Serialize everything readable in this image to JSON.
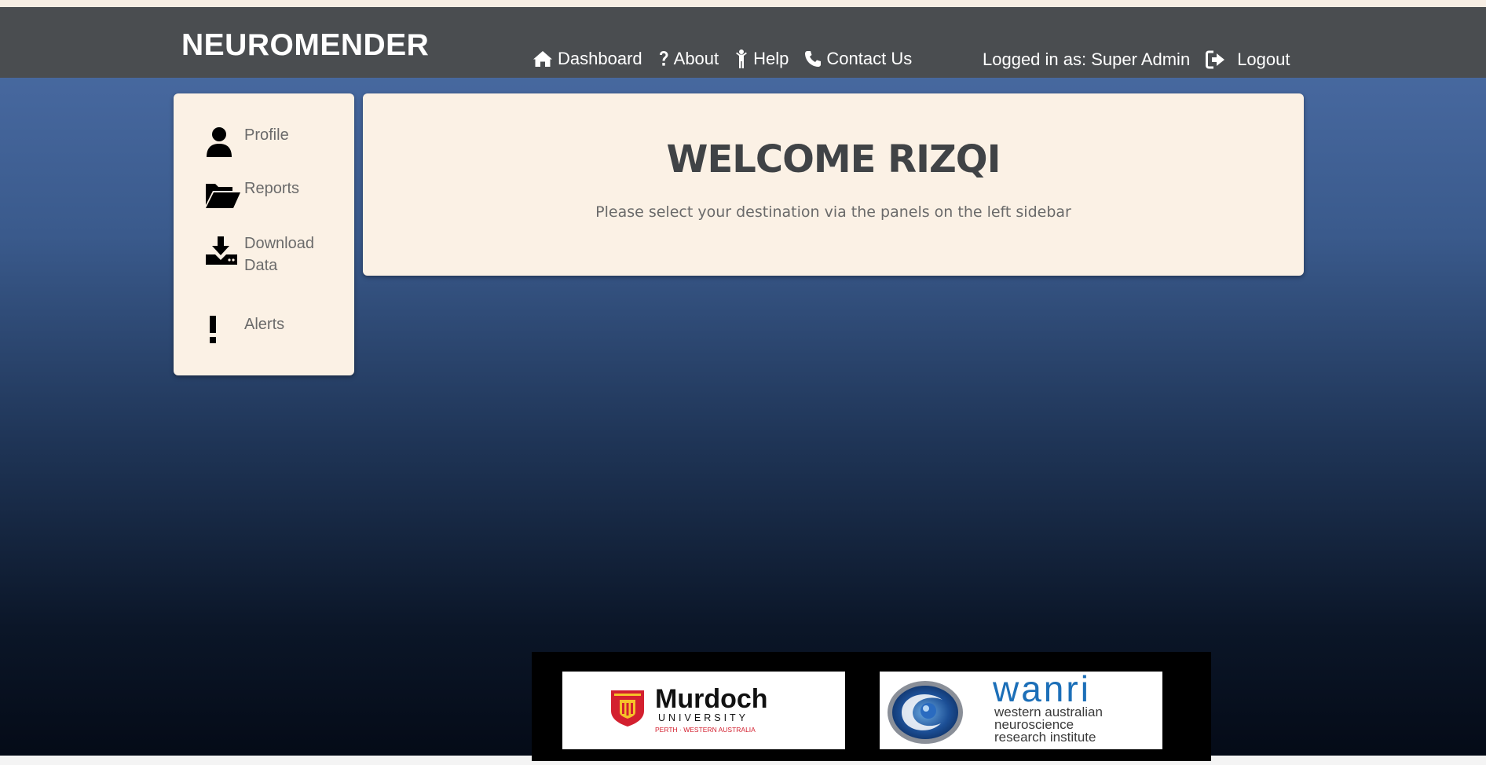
{
  "app": {
    "brand": "NEUROMENDER"
  },
  "nav": {
    "items": [
      {
        "label": "Dashboard",
        "icon": "home-icon"
      },
      {
        "label": "About",
        "icon": "question-icon"
      },
      {
        "label": "Help",
        "icon": "person-icon"
      },
      {
        "label": "Contact Us",
        "icon": "phone-icon"
      }
    ],
    "logged_in": "Logged in as: Super Admin",
    "logout": "Logout"
  },
  "sidebar": {
    "items": [
      {
        "label": "Profile",
        "icon": "user-icon"
      },
      {
        "label": "Reports",
        "icon": "folder-open-icon"
      },
      {
        "label": "Download Data",
        "icon": "download-icon"
      },
      {
        "label": "Alerts",
        "icon": "exclamation-icon"
      }
    ]
  },
  "main": {
    "title": "WELCOME RIZQI",
    "subtitle": "Please select your destination via the panels on the left sidebar"
  },
  "footer": {
    "murdoch": {
      "name": "Murdoch",
      "line2": "UNIVERSITY",
      "line3": "PERTH · WESTERN AUSTRALIA"
    },
    "wanri": {
      "name": "wanri",
      "line2": "western australian",
      "line3": "neuroscience",
      "line4": "research institute"
    }
  },
  "colors": {
    "navbar": "#4a4d50",
    "panel": "#fbf1e5",
    "title": "#404346",
    "murdoch_red": "#d3202f",
    "wanri_blue": "#1c6fb8"
  }
}
